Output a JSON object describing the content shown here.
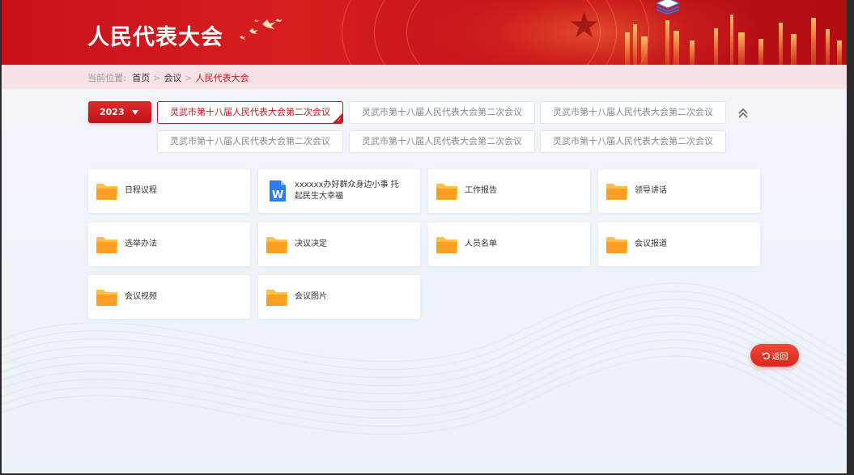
{
  "header": {
    "title": "人民代表大会"
  },
  "breadcrumb": {
    "prefix": "当前位置:",
    "items": [
      "首页",
      "会议",
      "人民代表大会"
    ],
    "separator": ">"
  },
  "filter": {
    "year": "2023",
    "meetings": [
      {
        "label": "灵武市第十八届人民代表大会第二次会议",
        "active": true
      },
      {
        "label": "灵武市第十八届人民代表大会第二次会议",
        "active": false
      },
      {
        "label": "灵武市第十八届人民代表大会第二次会议",
        "active": false
      },
      {
        "label": "灵武市第十八届人民代表大会第二次会议",
        "active": false
      },
      {
        "label": "灵武市第十八届人民代表大会第二次会议",
        "active": false
      },
      {
        "label": "灵武市第十八届人民代表大会第二次会议",
        "active": false
      }
    ]
  },
  "items": [
    {
      "label": "日程议程",
      "icon": "folder-icon"
    },
    {
      "label": "xxxxxx办好群众身边小事 托起民生大幸福",
      "icon": "word-doc-icon"
    },
    {
      "label": "工作报告",
      "icon": "folder-icon"
    },
    {
      "label": "领导讲话",
      "icon": "folder-icon"
    },
    {
      "label": "选举办法",
      "icon": "folder-icon"
    },
    {
      "label": "决议决定",
      "icon": "folder-icon"
    },
    {
      "label": "人员名单",
      "icon": "folder-icon"
    },
    {
      "label": "会议报道",
      "icon": "folder-icon"
    },
    {
      "label": "会议视频",
      "icon": "folder-icon"
    },
    {
      "label": "会议图片",
      "icon": "folder-icon"
    }
  ],
  "back_button": {
    "label": "返回"
  },
  "colors": {
    "primary_red": "#c4161c",
    "folder": "#ffb23a",
    "word": "#2b7cf0"
  }
}
